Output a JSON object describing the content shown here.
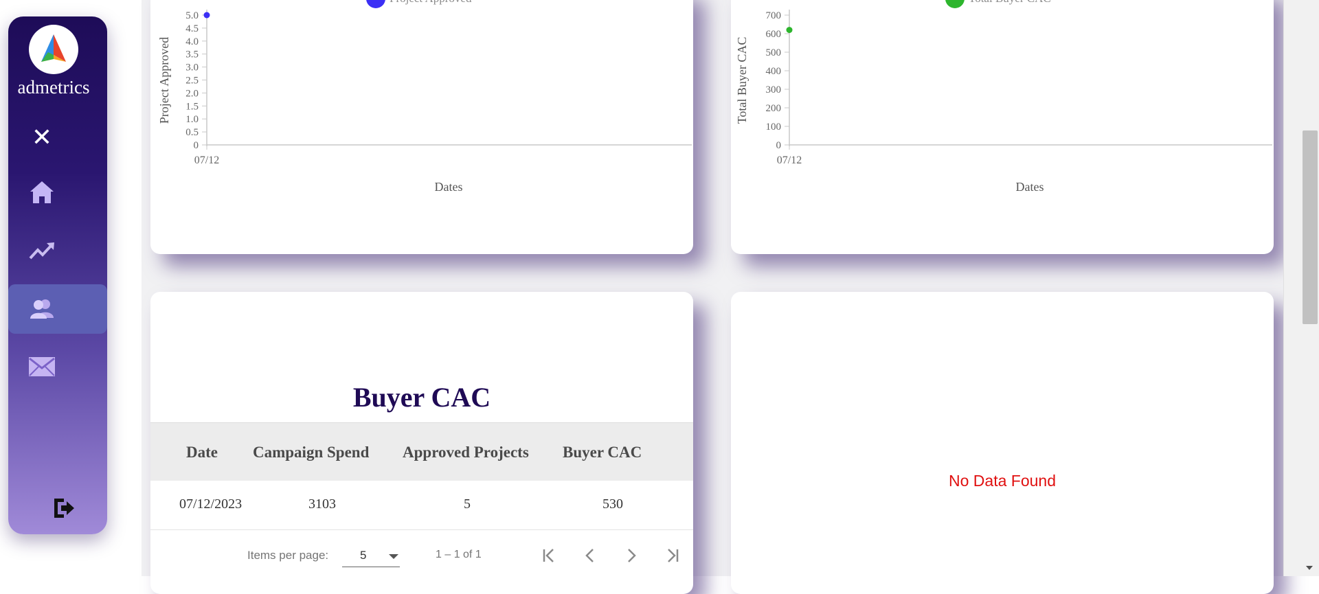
{
  "sidebar": {
    "brand": "admetrics",
    "close_glyph": "✕",
    "items": [
      {
        "name": "home",
        "icon": "home-icon"
      },
      {
        "name": "trends",
        "icon": "trending-up-icon"
      },
      {
        "name": "users",
        "icon": "users-icon",
        "active": true
      },
      {
        "name": "mail",
        "icon": "mail-icon"
      }
    ],
    "logout_icon": "logout-icon"
  },
  "chart_data": [
    {
      "type": "scatter",
      "legend": "Project Approved",
      "color": "#3b2ff5",
      "xlabel": "Dates",
      "ylabel": "Project Approved",
      "y_ticks": [
        "5.0",
        "4.5",
        "4.0",
        "3.5",
        "3.0",
        "2.5",
        "2.0",
        "1.5",
        "1.0",
        "0.5",
        "0"
      ],
      "x_ticks": [
        "07/12"
      ],
      "ylim": [
        0,
        5
      ],
      "points": [
        {
          "x": "07/12",
          "y": 5
        }
      ]
    },
    {
      "type": "scatter",
      "legend": "Total Buyer CAC",
      "color": "#2db52d",
      "xlabel": "Dates",
      "ylabel": "Total Buyer CAC",
      "y_ticks": [
        "700",
        "600",
        "500",
        "400",
        "300",
        "200",
        "100",
        "0"
      ],
      "x_ticks": [
        "07/12"
      ],
      "ylim": [
        0,
        700
      ],
      "points": [
        {
          "x": "07/12",
          "y": 620
        }
      ]
    }
  ],
  "table": {
    "title": "Buyer CAC",
    "columns": [
      "Date",
      "Campaign Spend",
      "Approved Projects",
      "Buyer CAC"
    ],
    "rows": [
      [
        "07/12/2023",
        "3103",
        "5",
        "530"
      ]
    ]
  },
  "pager": {
    "items_per_page_label": "Items per page:",
    "items_per_page_value": "5",
    "range": "1 – 1 of 1"
  },
  "empty_card": {
    "message": "No Data Found"
  }
}
